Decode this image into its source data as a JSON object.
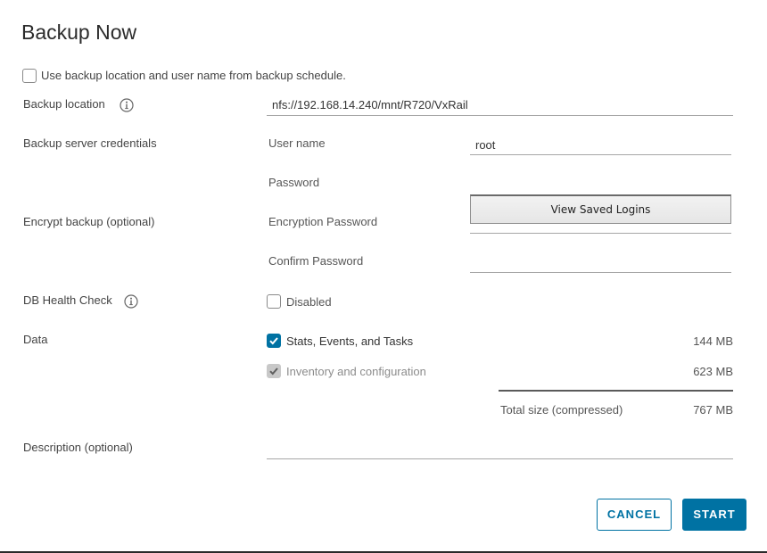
{
  "dialog": {
    "title": "Backup Now"
  },
  "schedule_option": {
    "label": "Use backup location and user name from backup schedule.",
    "checked": false
  },
  "backup_location": {
    "label": "Backup location",
    "value": "nfs://192.168.14.240/mnt/R720/VxRail"
  },
  "credentials": {
    "label": "Backup server credentials",
    "username_label": "User name",
    "username_value": "root",
    "password_label": "Password",
    "saved_logins_label": "View Saved Logins"
  },
  "encrypt": {
    "label": "Encrypt backup (optional)",
    "encryption_password_label": "Encryption Password",
    "confirm_password_label": "Confirm Password"
  },
  "db_health": {
    "label": "DB Health Check",
    "option_label": "Disabled",
    "checked": false
  },
  "data": {
    "label": "Data",
    "items": [
      {
        "label": "Stats, Events, and Tasks",
        "size": "144 MB",
        "checked": true,
        "disabled": false
      },
      {
        "label": "Inventory and configuration",
        "size": "623 MB",
        "checked": true,
        "disabled": true
      }
    ],
    "total_label": "Total size (compressed)",
    "total_size": "767 MB"
  },
  "description": {
    "label": "Description (optional)",
    "value": ""
  },
  "buttons": {
    "cancel": "CANCEL",
    "start": "START"
  },
  "colors": {
    "accent": "#0072a3",
    "text": "#333333",
    "disabled": "#8c8c8c"
  },
  "icons": {
    "info": "info-icon",
    "check": "checkmark-icon"
  }
}
